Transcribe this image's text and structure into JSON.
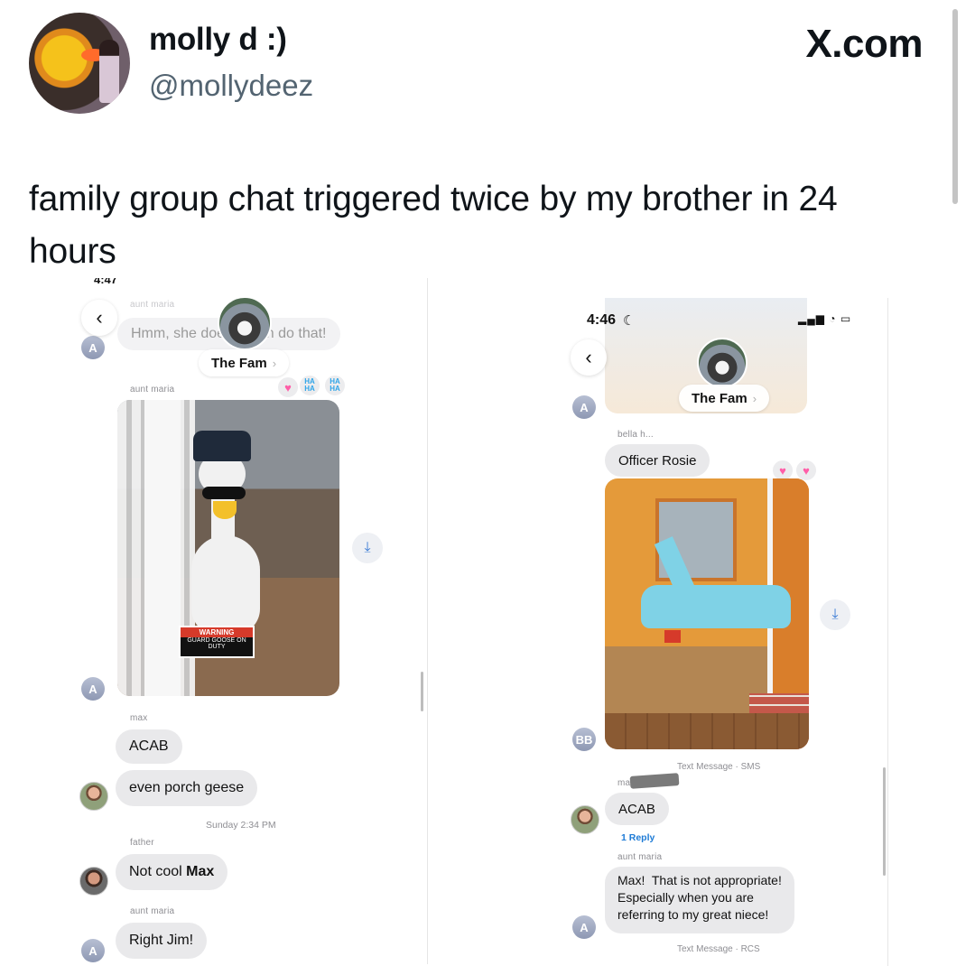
{
  "tweet": {
    "display_name": "molly d :)",
    "handle": "@mollydeez",
    "brand": "X.com",
    "text": "family group chat triggered twice by my brother in 24 hours"
  },
  "left_chat": {
    "status_time_partial": "4:47",
    "faded_sender": "aunt maria",
    "faded_message": "Hmm, she doesn't can do that!",
    "group_name": "The Fam",
    "chevron": "›",
    "back_glyph": "‹",
    "photo_sender": "aunt maria",
    "reactions": [
      "heart",
      "haha",
      "haha"
    ],
    "haha_text": "HA HA",
    "sign_warning": "WARNING",
    "sign_text": "GUARD GOOSE ON DUTY",
    "avatar_letter": "A",
    "messages": [
      {
        "sender": "max",
        "text": "ACAB"
      },
      {
        "sender": "",
        "text": "even porch geese"
      }
    ],
    "timestamp": "Sunday 2:34 PM",
    "father_sender": "father",
    "father_text_plain": "Not cool ",
    "father_text_bold": "Max",
    "aunt_sender": "aunt maria",
    "aunt_text": "Right Jim!"
  },
  "right_chat": {
    "status_time": "4:46",
    "group_name": "The Fam",
    "chevron": "›",
    "back_glyph": "‹",
    "avatar_letter": "A",
    "bella_sender": "bella h...",
    "bella_text": "Officer Rosie",
    "reactions": [
      "heart",
      "heart"
    ],
    "bb_avatar": "BB",
    "sms_label": "Text Message · SMS",
    "max_sender": "ma",
    "acab_text": "ACAB",
    "reply_count": "1 Reply",
    "aunt_sender": "aunt maria",
    "aunt_lines": [
      "Max!  That is not appropriate!",
      "Especially when you are",
      "referring to my great niece!"
    ],
    "rcs_label": "Text Message · RCS"
  },
  "colors": {
    "bubble_gray": "#e9e9eb",
    "meta_gray": "#8e8e93",
    "link_blue": "#1e7bd6"
  }
}
